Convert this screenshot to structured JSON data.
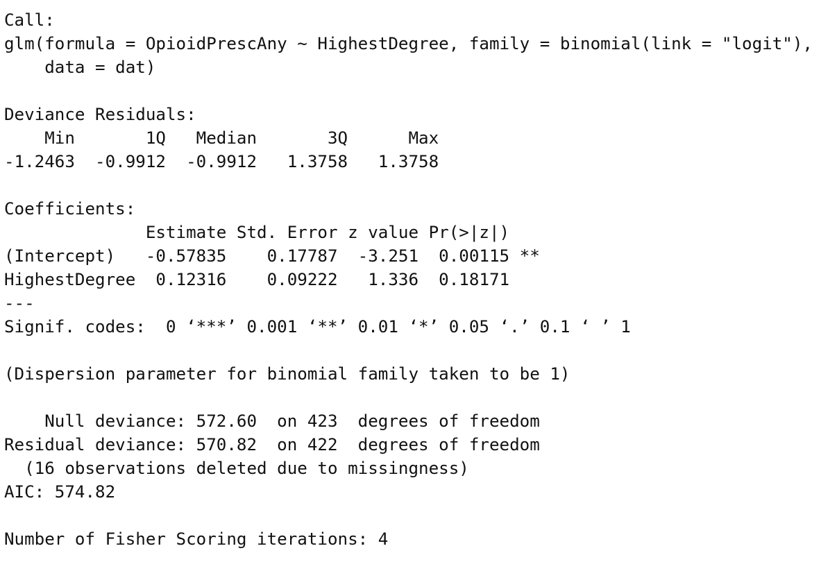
{
  "console": {
    "lines": [
      "Call:",
      "glm(formula = OpioidPrescAny ~ HighestDegree, family = binomial(link = \"logit\"),",
      "    data = dat)",
      "",
      "Deviance Residuals:",
      "    Min       1Q   Median       3Q      Max",
      "-1.2463  -0.9912  -0.9912   1.3758   1.3758",
      "",
      "Coefficients:",
      "              Estimate Std. Error z value Pr(>|z|)",
      "(Intercept)   -0.57835    0.17787  -3.251  0.00115 **",
      "HighestDegree  0.12316    0.09222   1.336  0.18171",
      "---",
      "Signif. codes:  0 ‘***’ 0.001 ‘**’ 0.01 ‘*’ 0.05 ‘.’ 0.1 ‘ ’ 1",
      "",
      "(Dispersion parameter for binomial family taken to be 1)",
      "",
      "    Null deviance: 572.60  on 423  degrees of freedom",
      "Residual deviance: 570.82  on 422  degrees of freedom",
      "  (16 observations deleted due to missingness)",
      "AIC: 574.82",
      "",
      "Number of Fisher Scoring iterations: 4"
    ]
  }
}
